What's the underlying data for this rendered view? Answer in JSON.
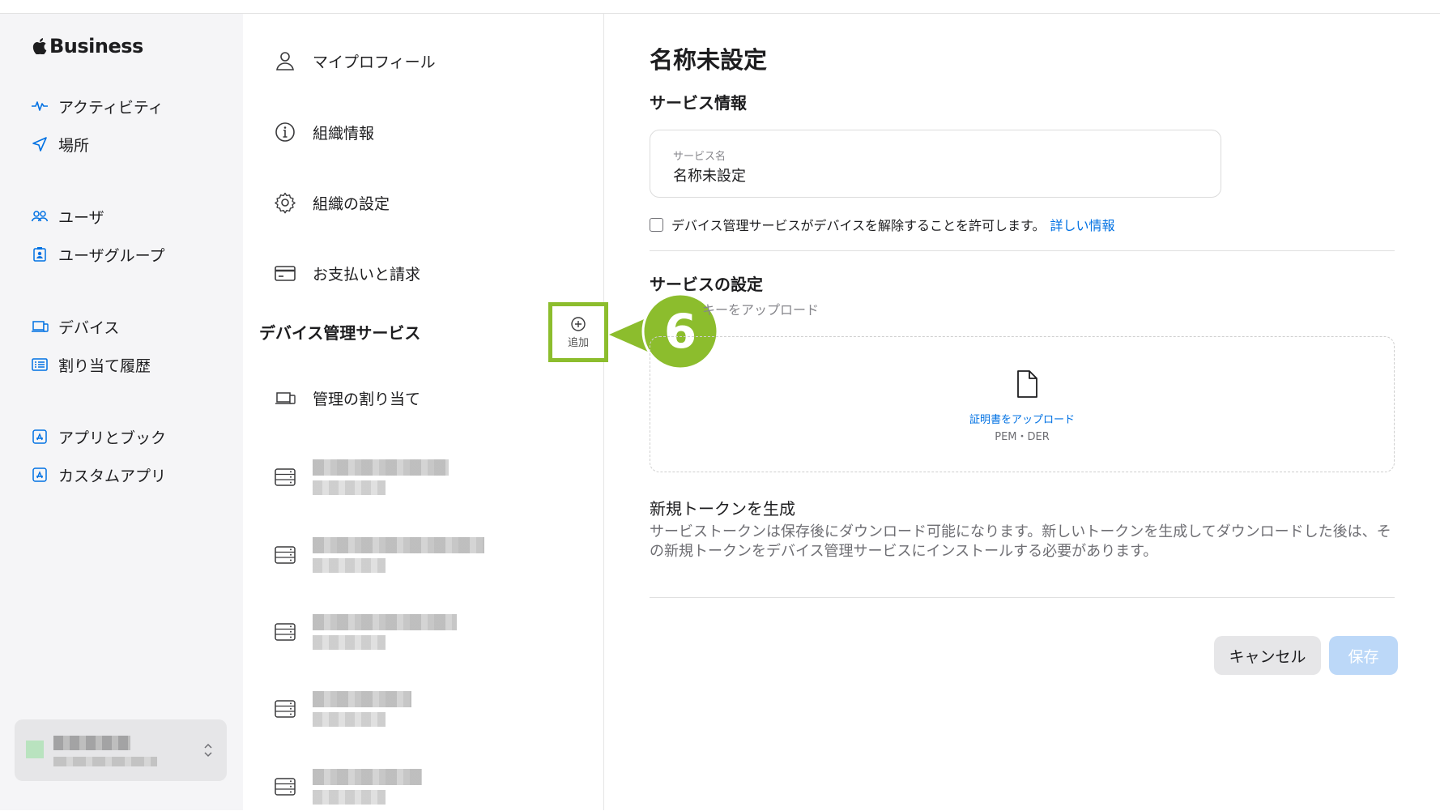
{
  "brand": {
    "name": "Business"
  },
  "sidebar": {
    "items": [
      {
        "label": "アクティビティ",
        "icon": "activity-icon"
      },
      {
        "label": "場所",
        "icon": "location-arrow-icon"
      },
      {
        "label": "ユーザ",
        "icon": "users-icon"
      },
      {
        "label": "ユーザグループ",
        "icon": "user-group-icon"
      },
      {
        "label": "デバイス",
        "icon": "devices-icon"
      },
      {
        "label": "割り当て履歴",
        "icon": "assignment-history-icon"
      },
      {
        "label": "アプリとブック",
        "icon": "apps-icon"
      },
      {
        "label": "カスタムアプリ",
        "icon": "custom-apps-icon"
      }
    ]
  },
  "settings_menu": {
    "items": [
      {
        "label": "マイプロフィール",
        "icon": "person-icon"
      },
      {
        "label": "組織情報",
        "icon": "info-icon"
      },
      {
        "label": "組織の設定",
        "icon": "gear-icon"
      },
      {
        "label": "お支払いと請求",
        "icon": "credit-card-icon"
      }
    ],
    "section_title": "デバイス管理サービス",
    "add_label": "追加",
    "assign_label": "管理の割り当て",
    "callout_number": "6"
  },
  "panel": {
    "title": "名称未設定",
    "service_info_heading": "サービス情報",
    "service_name_label": "サービス名",
    "service_name_value": "名称未設定",
    "checkbox_label": "デバイス管理サービスがデバイスを解除することを許可します。",
    "checkbox_link": "詳しい情報",
    "service_settings_heading": "サービスの設定",
    "upload_key_hint": "キーをアップロード",
    "upload_link": "証明書をアップロード",
    "upload_formats": "PEM・DER",
    "token_heading": "新規トークンを生成",
    "token_description": "サービストークンは保存後にダウンロード可能になります。新しいトークンを生成してダウンロードした後は、その新規トークンをデバイス管理サービスにインストールする必要があります。",
    "cancel_label": "キャンセル",
    "save_label": "保存"
  },
  "colors": {
    "accent": "#0071e3",
    "callout_green": "#8cbd2d",
    "save_disabled": "#bcd8f8"
  }
}
